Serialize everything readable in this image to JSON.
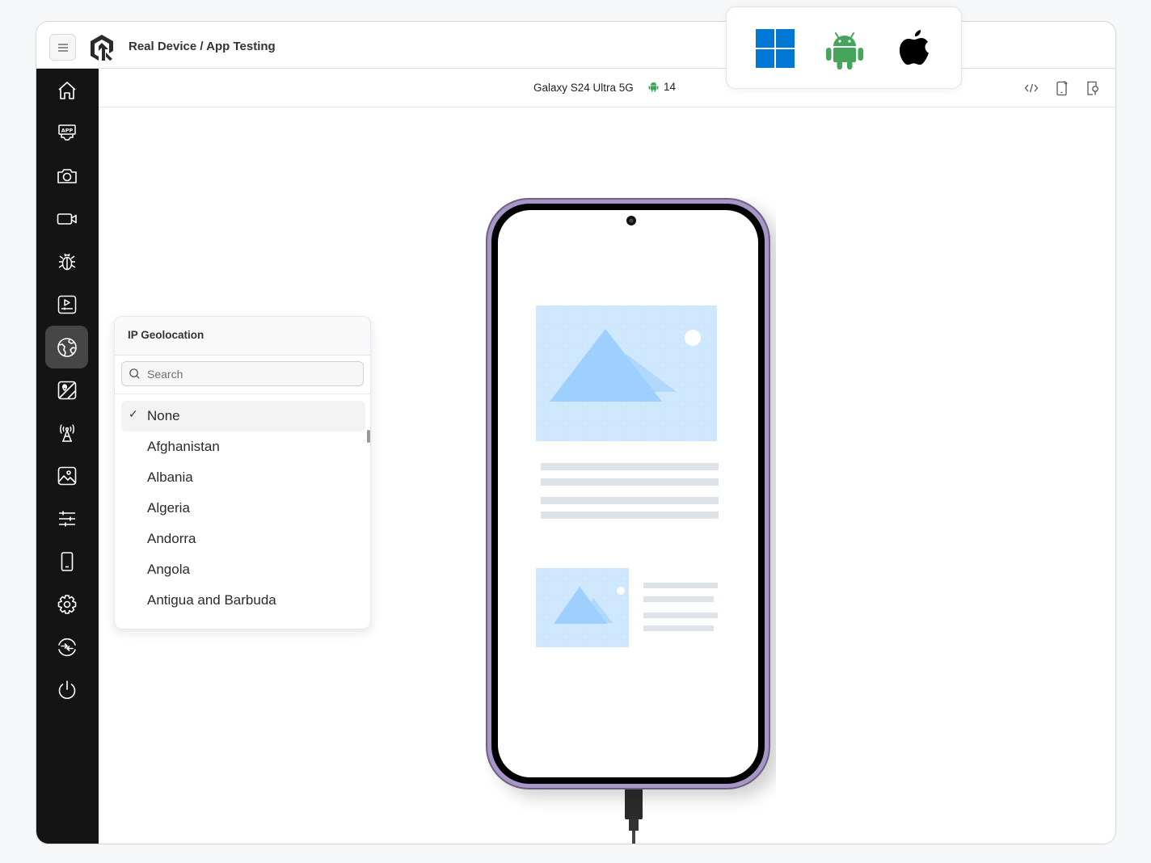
{
  "app": {
    "title": "Real Device / App Testing",
    "menu_icon": "hamburger-icon",
    "logo": "lambdatest-logo"
  },
  "device_bar": {
    "device_name": "Galaxy S24 Ultra 5G",
    "os_icon": "android-icon",
    "os_version": "14",
    "tools": [
      {
        "name": "code-inspector",
        "icon": "code-icon"
      },
      {
        "name": "device-network",
        "icon": "device-wifi-icon"
      },
      {
        "name": "device-search",
        "icon": "device-search-icon"
      }
    ]
  },
  "os_selector": {
    "options": [
      {
        "name": "windows",
        "icon": "windows-icon",
        "color": "#0078d4"
      },
      {
        "name": "android",
        "icon": "android-icon",
        "color": "#3ddc84"
      },
      {
        "name": "apple",
        "icon": "apple-icon",
        "color": "#000000"
      }
    ]
  },
  "sidebar": {
    "active_index": 6,
    "items": [
      {
        "name": "home",
        "icon": "home-icon"
      },
      {
        "name": "app",
        "icon": "app-upload-icon"
      },
      {
        "name": "screenshot",
        "icon": "camera-icon"
      },
      {
        "name": "record",
        "icon": "video-icon"
      },
      {
        "name": "debug",
        "icon": "bug-icon"
      },
      {
        "name": "media",
        "icon": "play-media-icon"
      },
      {
        "name": "geolocation",
        "icon": "globe-icon"
      },
      {
        "name": "gps-location",
        "icon": "map-pin-icon"
      },
      {
        "name": "network",
        "icon": "antenna-icon"
      },
      {
        "name": "gallery",
        "icon": "image-icon"
      },
      {
        "name": "settings-sliders",
        "icon": "sliders-icon"
      },
      {
        "name": "device",
        "icon": "phone-icon"
      },
      {
        "name": "settings",
        "icon": "gear-icon"
      },
      {
        "name": "switch-device",
        "icon": "switch-icon"
      },
      {
        "name": "end-session",
        "icon": "power-icon"
      }
    ]
  },
  "geo_panel": {
    "title": "IP Geolocation",
    "search_placeholder": "Search",
    "search_value": "",
    "selected": "None",
    "options": [
      "None",
      "Afghanistan",
      "Albania",
      "Algeria",
      "Andorra",
      "Angola",
      "Antigua and Barbuda"
    ]
  },
  "colors": {
    "sidebar_bg": "#141414",
    "active_item_bg": "#464646",
    "phone_frame": "#a896c8",
    "placeholder_blue": "#cfe8fd",
    "mountain_blue": "#9dcfff"
  }
}
